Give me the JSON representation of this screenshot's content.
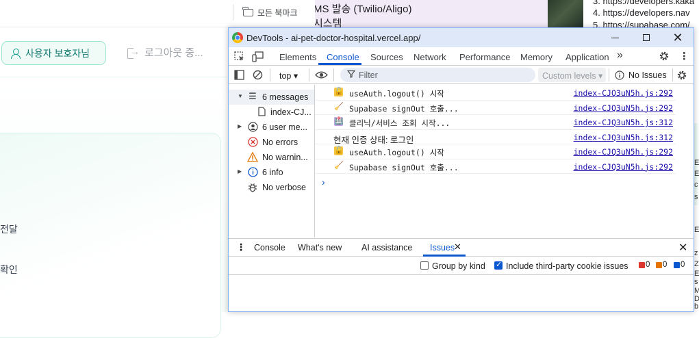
{
  "bookmarks": {
    "all_label": "모든 북마크"
  },
  "app": {
    "user_button": "사용자 보호자님",
    "logout_button": "로그아웃 중...",
    "card_line_1": "전달",
    "card_line_2": "확인"
  },
  "background": {
    "mid_line_1": "MS 발송 (Twilio/Aligo)",
    "mid_line_2": "시스템",
    "links": [
      "3. https://developers.kaka",
      "4. https://developers.nav",
      "5. https://supabase.com/"
    ],
    "strip_chars": [
      "E",
      "E",
      "c",
      "s",
      "E",
      "z",
      "Z",
      "E",
      "s",
      "M",
      "D",
      "b"
    ]
  },
  "devtools": {
    "title": "DevTools - ai-pet-doctor-hospital.vercel.app/",
    "tabs": [
      "Elements",
      "Console",
      "Sources",
      "Network",
      "Performance",
      "Memory",
      "Application"
    ],
    "active_tab": "Console",
    "more_tabs": "»",
    "toolbar": {
      "context": "top ▾",
      "filter_placeholder": "Filter",
      "levels": "Custom levels ▾",
      "issues": "No Issues"
    },
    "sidebar": [
      {
        "label": "6 messages",
        "icon": "list-icon",
        "expanded": true,
        "selected": true
      },
      {
        "label": "index-CJ...",
        "icon": "file-icon",
        "child": true
      },
      {
        "label": "6 user me...",
        "icon": "user-icon",
        "collapsed": true
      },
      {
        "label": "No errors",
        "icon": "error-icon"
      },
      {
        "label": "No warnin...",
        "icon": "warning-icon"
      },
      {
        "label": "6 info",
        "icon": "info-icon",
        "collapsed": true
      },
      {
        "label": "No verbose",
        "icon": "bug-icon"
      }
    ],
    "logs": [
      {
        "icon": "unlock-icon",
        "message": "useAuth.logout() 시작",
        "source": "index-CJQ3uN5h.js:292"
      },
      {
        "icon": "broom-icon",
        "message": "Supabase signOut 호출...",
        "source": "index-CJQ3uN5h.js:292"
      },
      {
        "icon": "hospital-icon",
        "message": "클리닉/서비스 조회 시작...",
        "source": "index-CJQ3uN5h.js:312"
      },
      {
        "icon": "",
        "message": "현재 인증 상태: 로그인",
        "source": "index-CJQ3uN5h.js:312"
      },
      {
        "icon": "unlock-icon",
        "message": "useAuth.logout() 시작",
        "source": "index-CJQ3uN5h.js:292"
      },
      {
        "icon": "broom-icon",
        "message": "Supabase signOut 호출...",
        "source": "index-CJQ3uN5h.js:292"
      }
    ],
    "prompt_symbol": "›",
    "drawer": {
      "tabs": [
        "Console",
        "What's new",
        "AI assistance",
        "Issues"
      ],
      "active_tab": "Issues",
      "group_by_kind": "Group by kind",
      "group_by_kind_checked": false,
      "third_party": "Include third-party cookie issues",
      "third_party_checked": true,
      "counts": {
        "errors": "0",
        "warnings": "0",
        "info": "0"
      }
    }
  },
  "colors": {
    "accent": "#0b57d0",
    "teal": "#0f766e",
    "titlebar": "#dee8f8"
  }
}
